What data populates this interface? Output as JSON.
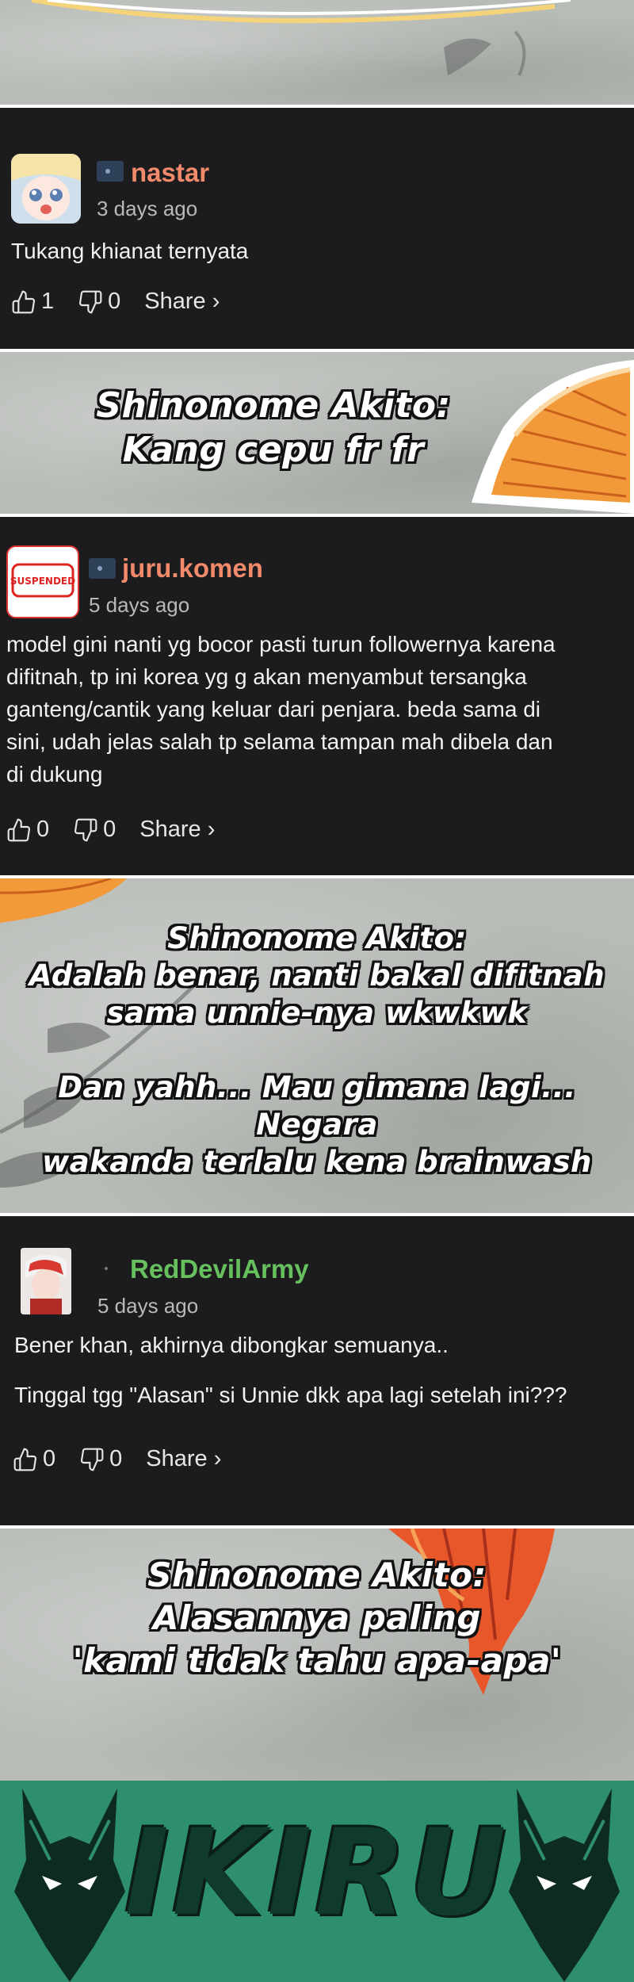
{
  "panels": {
    "p1": {
      "lines": [
        "Shinonome Akito:",
        "Kang cepu fr fr"
      ]
    },
    "p2": {
      "lines": [
        "Shinonome Akito:",
        "Adalah benar, nanti bakal difitnah",
        "sama unnie-nya wkwkwk",
        "",
        "Dan yahh... Mau gimana lagi... Negara",
        "wakanda terlalu kena brainwash"
      ]
    },
    "p3": {
      "lines": [
        "Shinonome Akito:",
        "Alasannya paling",
        "'kami tidak tahu apa-apa'"
      ]
    }
  },
  "comments": [
    {
      "username": "nastar",
      "username_color": "#f08a6b",
      "time": "3 days ago",
      "body": [
        "Tukang khianat ternyata"
      ],
      "likes": "1",
      "dislikes": "0",
      "share": "Share ›"
    },
    {
      "username": "juru.komen",
      "username_color": "#f08a6b",
      "time": "5 days ago",
      "avatar_text": "SUSPENDED",
      "body": [
        "model gini nanti yg bocor pasti turun followernya karena",
        "difitnah, tp ini korea yg g akan menyambut tersangka",
        "ganteng/cantik yang keluar dari penjara. beda sama di",
        "sini, udah jelas salah tp selama tampan mah dibela dan",
        "di dukung"
      ],
      "likes": "0",
      "dislikes": "0",
      "share": "Share ›"
    },
    {
      "username": "RedDevilArmy",
      "username_color": "#67c05e",
      "time": "5 days ago",
      "body": [
        "Bener khan, akhirnya dibongkar semuanya..",
        "",
        "Tinggal tgg \"Alasan\" si Unnie dkk apa lagi setelah ini???"
      ],
      "likes": "0",
      "dislikes": "0",
      "share": "Share ›"
    }
  ],
  "footer": {
    "logo_text": "IKIRU"
  },
  "colors": {
    "accent_orange": "#f29a3a",
    "footer_green": "#2e8f6c",
    "card_bg": "#1c1c1e"
  }
}
